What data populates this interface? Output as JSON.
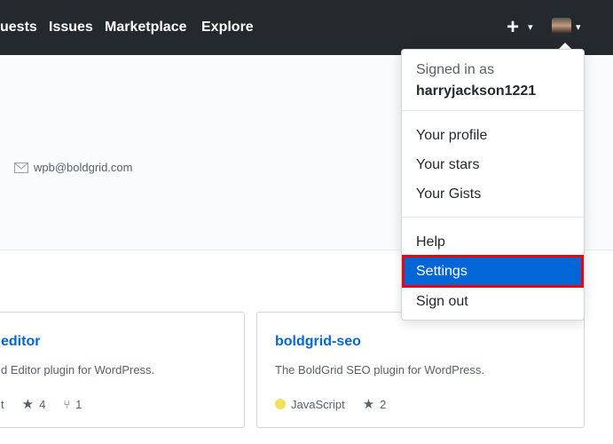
{
  "header": {
    "nav": [
      "uests",
      "Issues",
      "Marketplace",
      "Explore"
    ],
    "plus": "+",
    "caret": "▾"
  },
  "profile": {
    "email": "wpb@boldgrid.com"
  },
  "cards": [
    {
      "title": "editor",
      "description": "d Editor plugin for WordPress.",
      "language": "t",
      "stars": "4",
      "forks": "1"
    },
    {
      "title": "boldgrid-seo",
      "description": "The BoldGrid SEO plugin for WordPress.",
      "language": "JavaScript",
      "language_color": "#f1e05a",
      "stars": "2"
    }
  ],
  "dropdown": {
    "signed_in_as": "Signed in as",
    "username": "harryjackson1221",
    "items": [
      "Your profile",
      "Your stars",
      "Your Gists",
      "Help",
      "Settings",
      "Sign out"
    ]
  }
}
